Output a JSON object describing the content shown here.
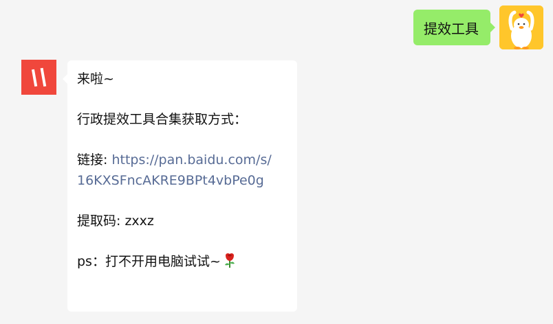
{
  "chat": {
    "user_message": {
      "text": "提效工具",
      "avatar": "duck-avatar",
      "bubble_color": "#95ec69"
    },
    "bot_message": {
      "avatar": "red-logo-avatar",
      "avatar_color": "#f0473c",
      "greeting": "来啦~",
      "intro": "行政提效工具合集获取方式：",
      "link_label": "链接: ",
      "link_line1": "https://pan.baidu.com/s/",
      "link_line2": "16KXSFncAKRE9BPt4vbPe0g",
      "code_label": "提取码: ",
      "code_value": "zxxz",
      "ps_text": "ps：打不开用电脑试试~",
      "emoji": "rose-icon",
      "link_color": "#576b95"
    }
  }
}
